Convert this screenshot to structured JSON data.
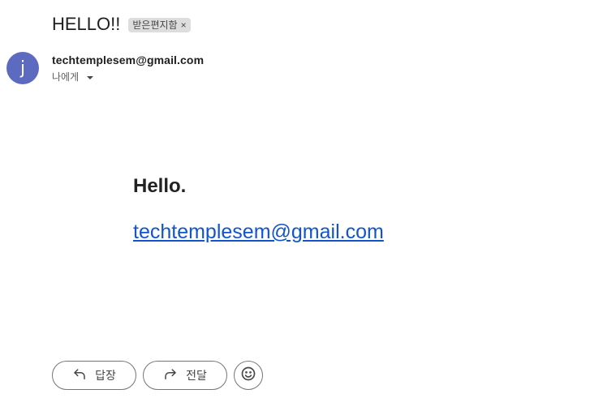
{
  "email": {
    "subject": "HELLO!!",
    "label": {
      "name": "받은편지함",
      "remove_glyph": "×"
    },
    "sender": {
      "avatar_letter": "j",
      "avatar_color": "#5c6bc0",
      "address": "techtemplesem@gmail.com"
    },
    "recipient_text": "나에게",
    "body": {
      "greeting": "Hello.",
      "link_text": "techtemplesem@gmail.com",
      "link_color": "#1155cc"
    }
  },
  "actions": {
    "reply_label": "답장",
    "reply_icon": "reply-arrow-icon",
    "forward_label": "전달",
    "forward_icon": "forward-arrow-icon",
    "emoji_icon": "smiley-face-icon"
  }
}
